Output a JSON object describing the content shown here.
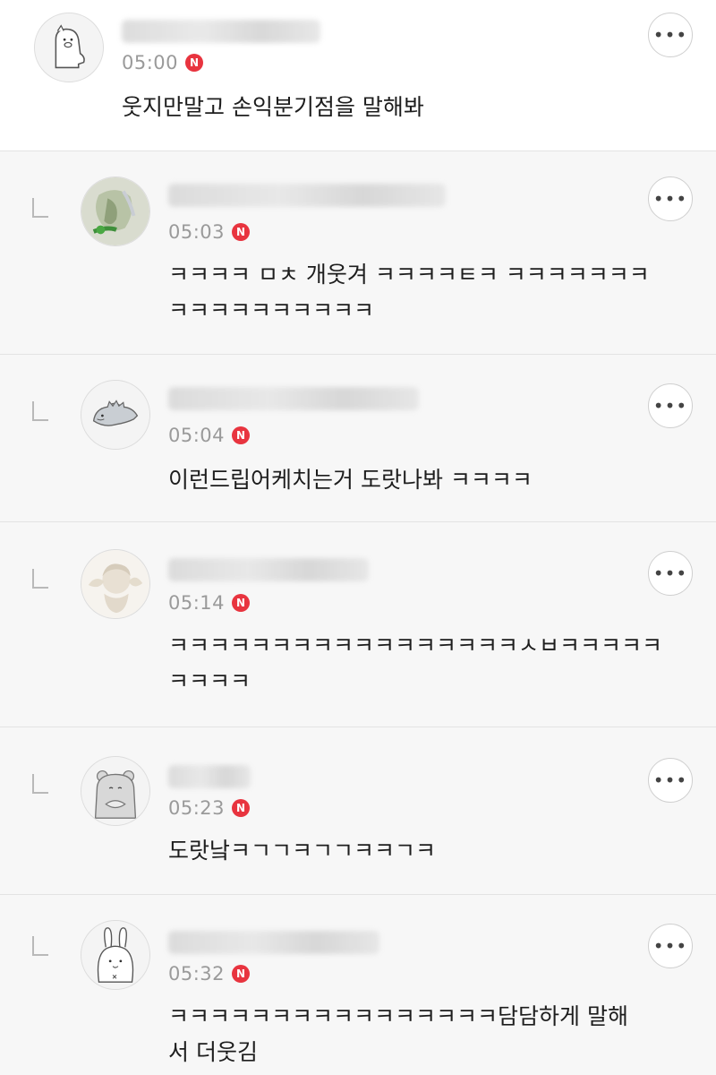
{
  "comments": [
    {
      "time": "05:00",
      "badge": "N",
      "more": "•••",
      "text": "웃지만말고 손익분기점을 말해봐",
      "avatar_icon": "pig-sketch-icon",
      "reply": false
    },
    {
      "time": "05:03",
      "badge": "N",
      "more": "•••",
      "text": "ㅋㅋㅋㅋ ㅁㅊ 개웃겨 ㅋㅋㅋㅋㅌㅋ ㅋㅋㅋㅋㅋㅋㅋ\nㅋㅋㅋㅋㅋㅋㅋㅋㅋㅋ",
      "avatar_icon": "green-flower-icon",
      "reply": true
    },
    {
      "time": "05:04",
      "badge": "N",
      "more": "•••",
      "text": "이런드립어케치는거 도랏나봐 ㅋㅋㅋㅋ",
      "avatar_icon": "dinosaur-sketch-icon",
      "reply": true
    },
    {
      "time": "05:14",
      "badge": "N",
      "more": "•••",
      "text": "ㅋㅋㅋㅋㅋㅋㅋㅋㅋㅋㅋㅋㅋㅋㅋㅋㅋㅅㅂㅋㅋㅋㅋㅋ\nㅋㅋㅋㅋ",
      "avatar_icon": "cherub-statue-icon",
      "reply": true
    },
    {
      "time": "05:23",
      "badge": "N",
      "more": "•••",
      "text": "도랏낰ㅋㄱㄱㅋㄱㄱㅋㅋㄱㅋ",
      "avatar_icon": "bear-sketch-icon",
      "reply": true
    },
    {
      "time": "05:32",
      "badge": "N",
      "more": "•••",
      "text": "ㅋㅋㅋㅋㅋㅋㅋㅋㅋㅋㅋㅋㅋㅋㅋㅋ담담하게 말해\n서 더웃김",
      "avatar_icon": "rabbit-sketch-icon",
      "reply": true
    }
  ],
  "colors": {
    "badge": "#e8343f",
    "time": "#9a9a9a",
    "reply_bg": "#f7f7f7",
    "divider": "#e3e3e3"
  }
}
